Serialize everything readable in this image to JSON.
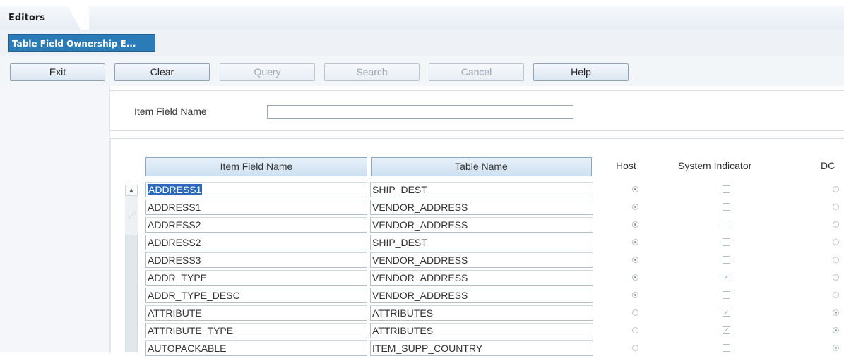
{
  "window": {
    "title": "Editors"
  },
  "page_tab": {
    "label": "Table Field Ownership E..."
  },
  "toolbar": {
    "exit": "Exit",
    "clear": "Clear",
    "query": "Query",
    "search": "Search",
    "cancel": "Cancel",
    "help": "Help"
  },
  "search": {
    "label": "Item Field Name",
    "value": ""
  },
  "table": {
    "headers": {
      "item_field_name": "Item Field Name",
      "table_name": "Table Name",
      "host": "Host",
      "system_indicator": "System Indicator",
      "dc": "DC"
    },
    "rows": [
      {
        "field": "ADDRESS1",
        "table": "SHIP_DEST",
        "host": true,
        "sys": false,
        "dc": false,
        "selected": true
      },
      {
        "field": "ADDRESS1",
        "table": "VENDOR_ADDRESS",
        "host": true,
        "sys": false,
        "dc": false
      },
      {
        "field": "ADDRESS2",
        "table": "VENDOR_ADDRESS",
        "host": true,
        "sys": false,
        "dc": false
      },
      {
        "field": "ADDRESS2",
        "table": "SHIP_DEST",
        "host": true,
        "sys": false,
        "dc": false
      },
      {
        "field": "ADDRESS3",
        "table": "VENDOR_ADDRESS",
        "host": true,
        "sys": false,
        "dc": false
      },
      {
        "field": "ADDR_TYPE",
        "table": "VENDOR_ADDRESS",
        "host": true,
        "sys": true,
        "dc": false
      },
      {
        "field": "ADDR_TYPE_DESC",
        "table": "VENDOR_ADDRESS",
        "host": true,
        "sys": false,
        "dc": false
      },
      {
        "field": "ATTRIBUTE",
        "table": "ATTRIBUTES",
        "host": false,
        "sys": true,
        "dc": true
      },
      {
        "field": "ATTRIBUTE_TYPE",
        "table": "ATTRIBUTES",
        "host": false,
        "sys": true,
        "dc": true
      },
      {
        "field": "AUTOPACKABLE",
        "table": "ITEM_SUPP_COUNTRY",
        "host": false,
        "sys": false,
        "dc": true
      }
    ]
  },
  "icons": {
    "scroll_up": "scroll-up-arrow-icon",
    "checkmark": "checkmark-icon"
  }
}
